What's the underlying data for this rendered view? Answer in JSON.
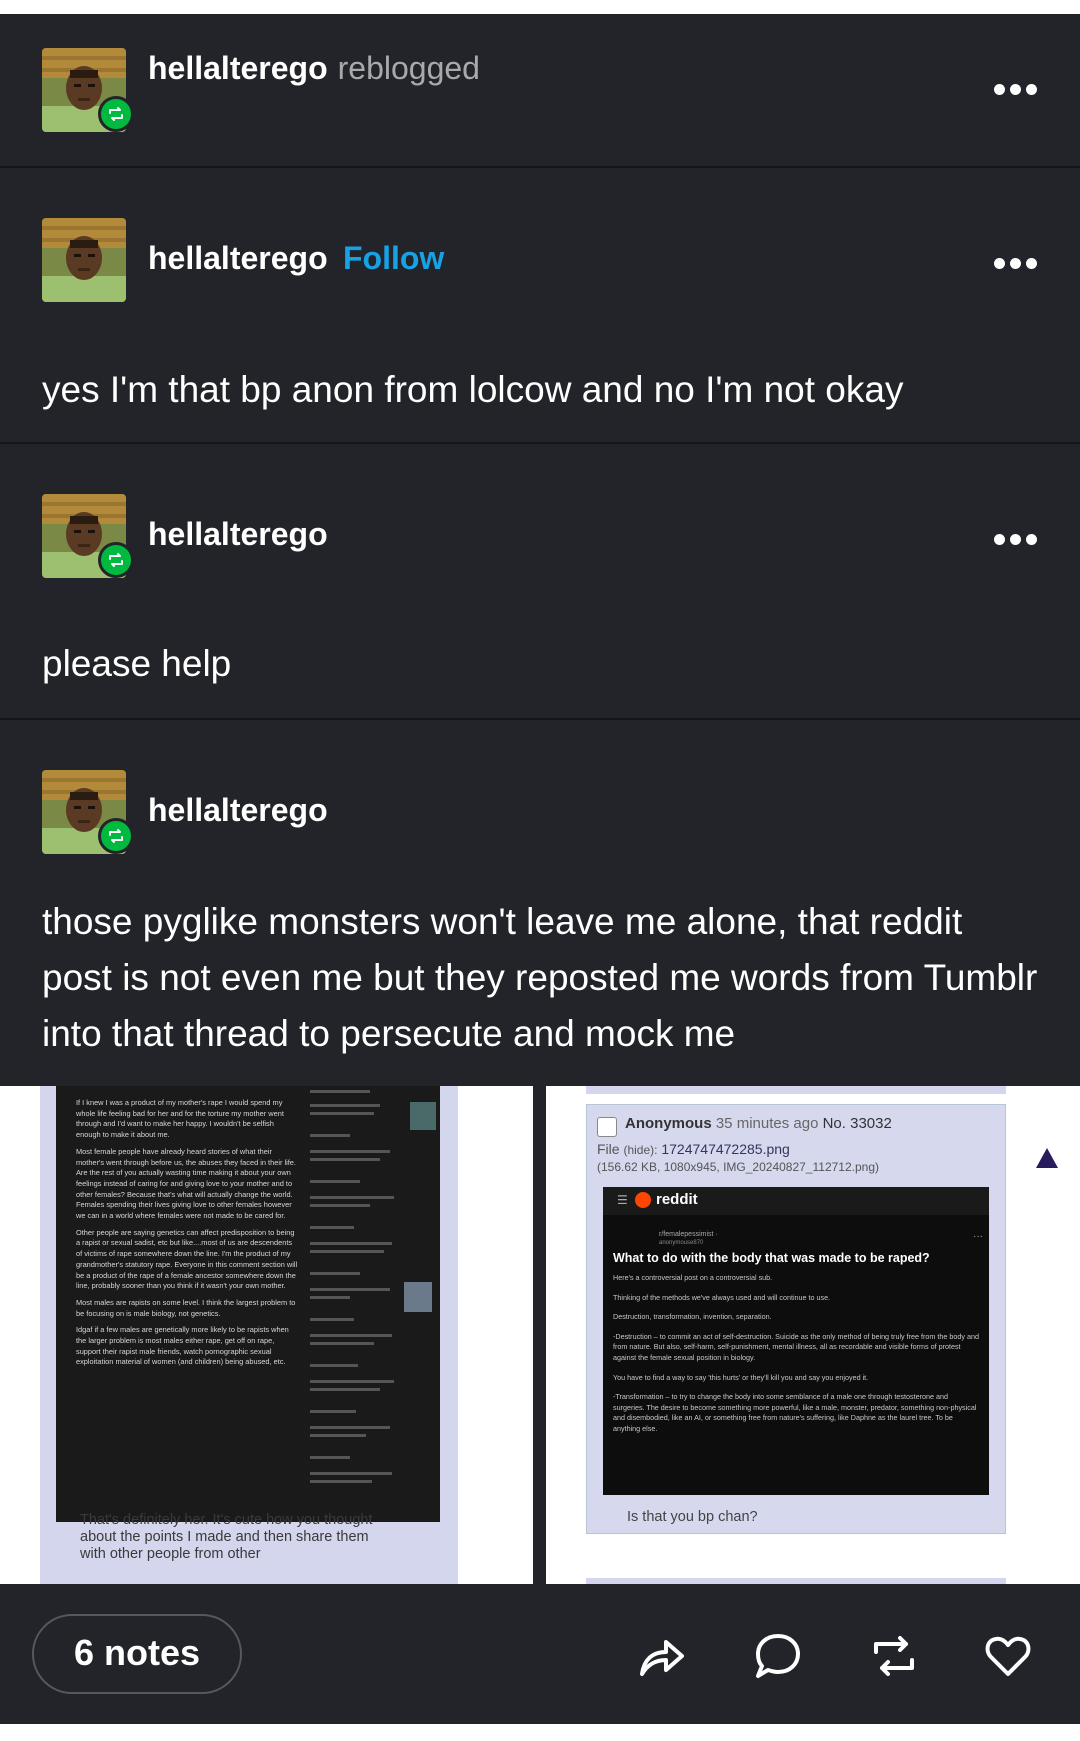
{
  "header": {
    "username": "hellalterego",
    "action": "reblogged"
  },
  "posts": [
    {
      "username": "hellalterego",
      "follow_label": "Follow",
      "text": "yes I'm that bp anon from lolcow and no I'm not okay"
    },
    {
      "username": "hellalterego",
      "text": "please help"
    },
    {
      "username": "hellalterego",
      "text": "those pyglike monsters won't leave me alone, that reddit post is not even me but they reposted me words from Tumblr into that thread to persecute and mock me"
    }
  ],
  "left_image": {
    "paragraphs": [
      "If I knew I was a product of my mother's rape I would spend my whole life feeling bad for her and for the torture my mother went through and I'd want to make her happy. I wouldn't be selfish enough to make it about me.",
      "Most female people have already heard stories of what their mother's went through before us, the abuses they faced in their life. Are the rest of you actually wasting time making it about your own feelings instead of caring for and giving love to your mother and to other females? Because that's what will actually change the world. Females spending their lives giving love to other females however we can in a world where females were not made to be cared for.",
      "Other people are saying genetics can affect predisposition to being a rapist or sexual sadist, etc but like....most of us are descendents of victims of rape somewhere down the line. I'm the product of my grandmother's statutory rape. Everyone in this comment section will be a product of the rape of a female ancestor somewhere down the line, probably sooner than you think if it wasn't your own mother.",
      "Most males are rapists on some level. I think the largest problem to be focusing on is male biology, not genetics.",
      "Idgaf if a few males are genetically more likely to be rapists when the larger problem is most males either rape, get off on rape, support their rapist male friends, watch pornographic sexual exploitation material of women (and children) being abused, etc."
    ],
    "caption": "That's definitely her. It's cute how you thought about the points I made and then share them with other people from other"
  },
  "right_image": {
    "poster": "Anonymous",
    "time": "35 minutes ago",
    "post_no": "No. 33032",
    "file_label": "File",
    "file_hide": "(hide):",
    "file_name": "1724747472285.png",
    "file_meta": "(156.62 KB, 1080x945, IMG_20240827_112712.png)",
    "reddit_brand": "reddit",
    "sub": "r/femalepessimist ·",
    "user": "anonymouse870",
    "reddit_title": "What to do with the body that was made to be raped?",
    "reddit_lines": [
      "Here's a controversial post on a controversial sub.",
      "Thinking of the methods we've always used and will continue to use.",
      "Destruction, transformation, invention, separation.",
      "-Destruction – to commit an act of self-destruction. Suicide as the only method of being truly free from the body and from nature. But also, self-harm, self-punishment, mental illness, all as recordable and visible forms of protest against the female sexual position in biology.",
      "You have to find a way to say 'this hurts' or they'll kill you and say you enjoyed it.",
      "-Transformation – to try to change the body into some semblance of a male one through testosterone and surgeries. The desire to become something more powerful, like a male, monster, predator, something non-physical and disembodied, like an AI, or something free from nature's suffering, like Daphne as the laurel tree. To be anything else."
    ],
    "reply_text": "Is that you bp chan?"
  },
  "footer": {
    "notes_count": "6 notes"
  },
  "colors": {
    "background": "#222429",
    "follow": "#18a2e6",
    "reblog_badge": "#00b93f"
  }
}
